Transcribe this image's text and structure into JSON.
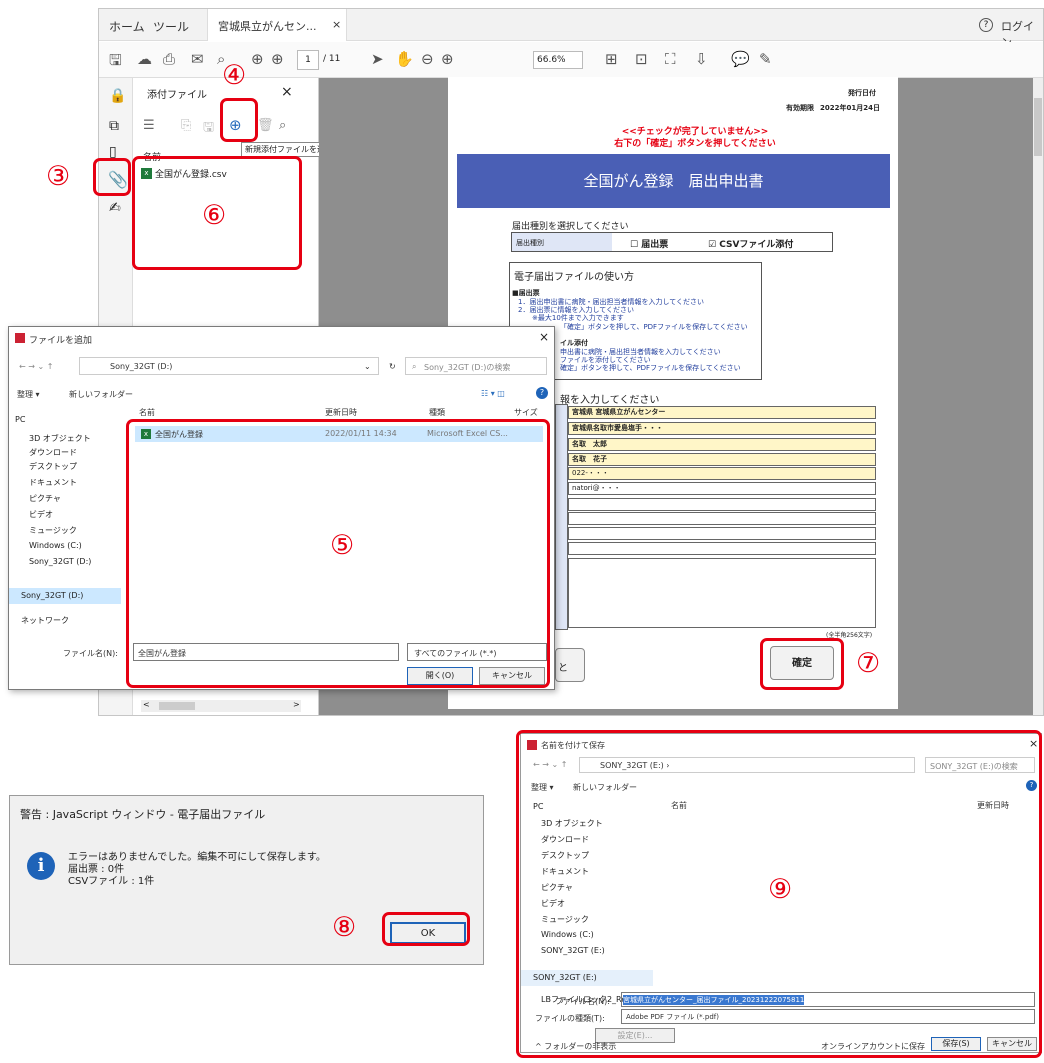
{
  "markers": {
    "m3": "③",
    "m4": "④",
    "m5": "⑤",
    "m6": "⑥",
    "m7": "⑦",
    "m8": "⑧",
    "m9": "⑨"
  },
  "acrobat": {
    "tab_home": "ホーム",
    "tab_tools": "ツール",
    "tab_doc": "宮城県立がんセン...",
    "tab_close": "×",
    "help": "?",
    "login": "ログイン",
    "page_current": "1",
    "page_total": "/ 11",
    "zoom": "66.6%",
    "attachments_title": "添付ファイル",
    "attachments_close": "×",
    "col_name": "名前",
    "tooltip_add": "新規添付ファイルを追加",
    "attached_file": "全国がん登録.csv",
    "scroll_left": "<",
    "scroll_right": ">"
  },
  "pdf": {
    "issue_label": "発行日付",
    "date_label": "有効期限",
    "date_value": "2022年01月24日",
    "warning_line1": "<<チェックが完了していません>>",
    "warning_line2": "右下の「確定」ボタンを押してください",
    "title": "全国がん登録　届出申出書",
    "section1": "届出種別を選択してください",
    "kind_label": "届出種別",
    "kind_form": "☐ 届出票",
    "kind_csv": "☑ CSVファイル添付",
    "section2": "電子届出ファイルの使い方",
    "howto_h1": "■届出票",
    "howto_l1": "1．届出申出書に病院・届出担当者情報を入力してください",
    "howto_l2": "2．届出票に情報を入力してください",
    "howto_l3": "※最大10件まで入力できます",
    "howto_l4": "「確定」ボタンを押して、PDFファイルを保存してください",
    "howto_h2": "イル添付",
    "howto_l5": "申出書に病院・届出担当者情報を入力してください",
    "howto_l6": "ファイルを添付してください",
    "howto_l7": "確定」ボタンを押して、PDFファイルを保存してください",
    "section3": "報を入力してください",
    "rows": [
      "宮城県 宮城県立がんセンター",
      "宮城県名取市愛島塩手・・・",
      "名取　太郎",
      "名取　花子",
      "022-・・・",
      "natori@・・・"
    ],
    "note": "(全半角256文字)",
    "confirm": "確定",
    "cut_btn": "と"
  },
  "filedlg": {
    "title": "ファイルを追加",
    "close": "×",
    "path": "Sony_32GT (D:)",
    "search": "Sony_32GT (D:)の検索",
    "organize": "整理 ▾",
    "new_folder": "新しいフォルダー",
    "nav": [
      "PC",
      "3D オブジェクト",
      "ダウンロード",
      "デスクトップ",
      "ドキュメント",
      "ピクチャ",
      "ビデオ",
      "ミュージック",
      "Windows (C:)",
      "Sony_32GT (D:)",
      "Sony_32GT (D:)",
      "ネットワーク"
    ],
    "col_name": "名前",
    "col_date": "更新日時",
    "col_type": "種類",
    "col_size": "サイズ",
    "file_name": "全国がん登録",
    "file_date": "2022/01/11 14:34",
    "file_type": "Microsoft Excel CS...",
    "filename_label": "ファイル名(N):",
    "filename_value": "全国がん登録",
    "filter": "すべてのファイル (*.*)",
    "open": "開く(O)",
    "cancel": "キャンセル"
  },
  "alert": {
    "title": "警告 : JavaScript ウィンドウ - 電子届出ファイル",
    "line1": "エラーはありませんでした。編集不可にして保存します。",
    "line2": "届出票 : 0件",
    "line3": "CSVファイル : 1件",
    "ok": "OK"
  },
  "savedlg": {
    "title": "名前を付けて保存",
    "close": "×",
    "path": "SONY_32GT (E:) ›",
    "search": "SONY_32GT (E:)の検索",
    "organize": "整理 ▾",
    "new_folder": "新しいフォルダー",
    "nav": [
      "PC",
      "3D オブジェクト",
      "ダウンロード",
      "デスクトップ",
      "ドキュメント",
      "ピクチャ",
      "ビデオ",
      "ミュージック",
      "Windows (C:)",
      "SONY_32GT (E:)",
      "SONY_32GT (E:)",
      "LBファイルロック2_Readme"
    ],
    "col_name": "名前",
    "col_date": "更新日時",
    "filename_label": "ファイル名(N):",
    "filename_value": "宮城県立がんセンター_届出ファイル_20231222075811",
    "type_label": "ファイルの種類(T):",
    "type_value": "Adobe PDF ファイル (*.pdf)",
    "settings": "設定(E)...",
    "hide_folders": "^ フォルダーの非表示",
    "online": "オンラインアカウントに保存",
    "save": "保存(S)",
    "cancel": "キャンセル"
  },
  "colors": {
    "accent_red": "#e60012",
    "pdf_blue": "#4a5fb5",
    "highlight": "#cce8ff"
  }
}
